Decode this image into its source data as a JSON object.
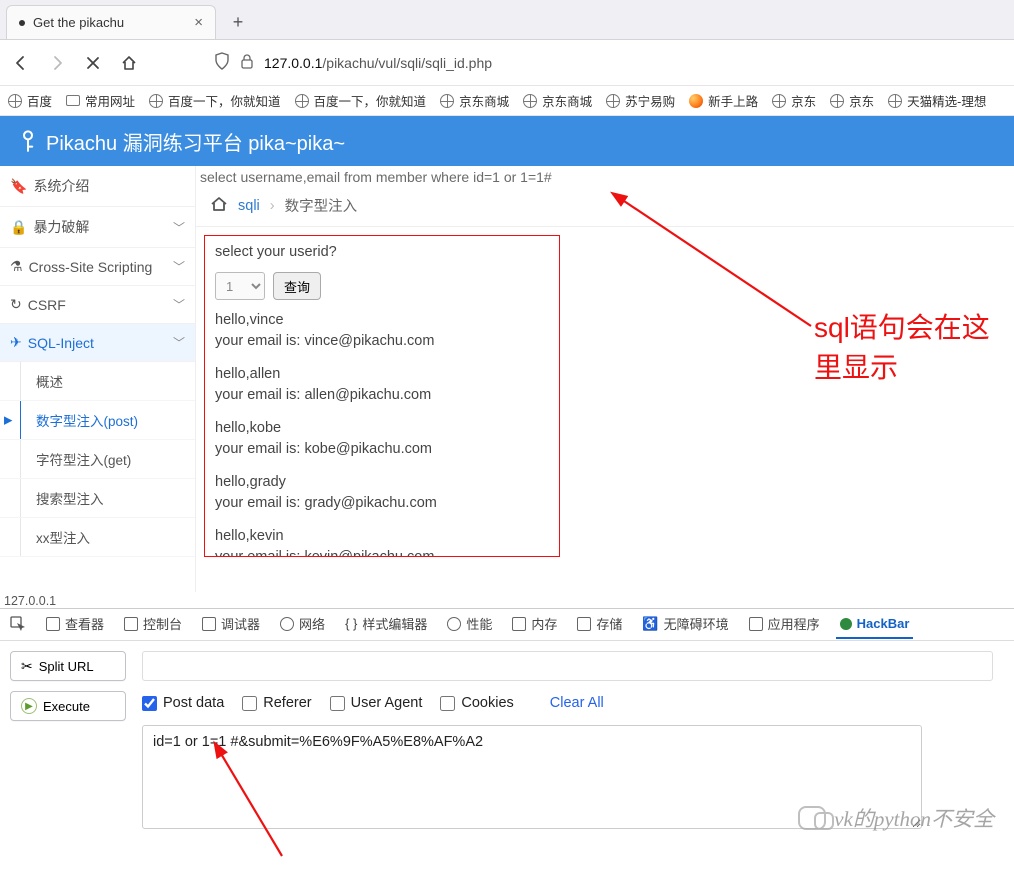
{
  "tab": {
    "title": "Get the pikachu"
  },
  "nav": {
    "url_host": "127.0.0.1",
    "url_path": "/pikachu/vul/sqli/sqli_id.php"
  },
  "bookmarks": [
    {
      "label": "百度",
      "icon": "globe"
    },
    {
      "label": "常用网址",
      "icon": "folder"
    },
    {
      "label": "百度一下，你就知道",
      "icon": "globe"
    },
    {
      "label": "百度一下，你就知道",
      "icon": "globe"
    },
    {
      "label": "京东商城",
      "icon": "globe"
    },
    {
      "label": "京东商城",
      "icon": "globe"
    },
    {
      "label": "苏宁易购",
      "icon": "globe"
    },
    {
      "label": "新手上路",
      "icon": "fox"
    },
    {
      "label": "京东",
      "icon": "globe"
    },
    {
      "label": "京东",
      "icon": "globe"
    },
    {
      "label": "天猫精选-理想",
      "icon": "globe"
    }
  ],
  "header": {
    "title": "Pikachu 漏洞练习平台 pika~pika~"
  },
  "sidebar": {
    "items": [
      {
        "label": "系统介绍",
        "icon": "tag"
      },
      {
        "label": "暴力破解",
        "icon": "lock",
        "chev": true
      },
      {
        "label": "Cross-Site Scripting",
        "icon": "flask",
        "chev": true
      },
      {
        "label": "CSRF",
        "icon": "refresh",
        "chev": true
      },
      {
        "label": "SQL-Inject",
        "icon": "plane",
        "chev": true,
        "active": true
      }
    ],
    "subs": [
      {
        "label": "概述"
      },
      {
        "label": "数字型注入(post)",
        "selected": true
      },
      {
        "label": "字符型注入(get)"
      },
      {
        "label": "搜索型注入"
      },
      {
        "label": "xx型注入"
      }
    ]
  },
  "content": {
    "sql_preview": "select username,email from member where id=1 or 1=1#",
    "breadcrumb": {
      "link": "sqli",
      "current": "数字型注入"
    },
    "prompt": "select your userid?",
    "select_value": "1",
    "query_btn": "查询",
    "records": [
      {
        "hello": "hello,vince",
        "email": "your email is: vince@pikachu.com"
      },
      {
        "hello": "hello,allen",
        "email": "your email is: allen@pikachu.com"
      },
      {
        "hello": "hello,kobe",
        "email": "your email is: kobe@pikachu.com"
      },
      {
        "hello": "hello,grady",
        "email": "your email is: grady@pikachu.com"
      },
      {
        "hello": "hello,kevin",
        "email": "your email is: kevin@pikachu.com"
      }
    ],
    "annotation": "sql语句会在这里显示"
  },
  "status": "127.0.0.1",
  "devtools": {
    "tabs": [
      "查看器",
      "控制台",
      "调试器",
      "网络",
      "样式编辑器",
      "性能",
      "内存",
      "存储",
      "无障碍环境",
      "应用程序",
      "HackBar"
    ],
    "split_btn": "Split URL",
    "execute_btn": "Execute",
    "checks": {
      "post": "Post data",
      "referer": "Referer",
      "ua": "User Agent",
      "cookies": "Cookies"
    },
    "clear": "Clear All",
    "payload": "id=1 or 1=1 #&submit=%E6%9F%A5%E8%AF%A2"
  },
  "watermark": "vk的python不安全"
}
